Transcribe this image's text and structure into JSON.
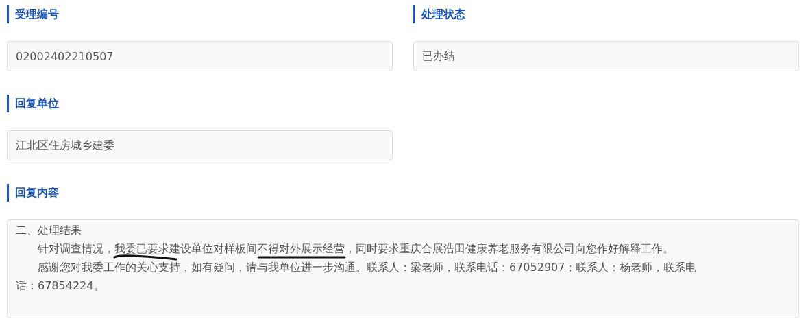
{
  "fields": [
    {
      "label": "受理编号",
      "value": "02002402210507"
    },
    {
      "label": "处理状态",
      "value": "已办结"
    },
    {
      "label": "回复单位",
      "value": "江北区住房城乡建委"
    }
  ],
  "reply": {
    "label": "回复内容",
    "lines": [
      {
        "text": "二、处理结果",
        "indent": false
      },
      {
        "text": "针对调查情况，我委已要求建设单位对样板间不得对外展示经营，同时要求重庆合展浩田健康养老服务有限公司向您作好解释工作。",
        "indent": true
      },
      {
        "text": "感谢您对我委工作的关心支持，如有疑问，请与我单位进一步沟通。联系人：梁老师，联系电话：67052907；联系人：杨老师，联系电",
        "indent": true
      },
      {
        "text": "话：67854224。",
        "indent": false
      }
    ]
  }
}
